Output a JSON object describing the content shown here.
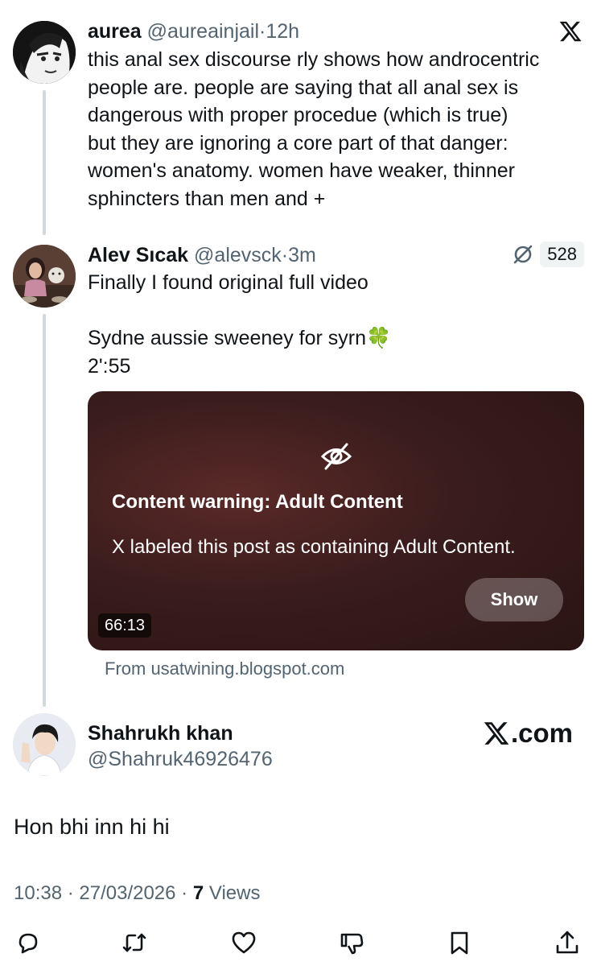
{
  "tweet1": {
    "name": "aurea",
    "handle": "@aureainjail",
    "sep": "·",
    "time": "12h",
    "lines": [
      "this anal sex discourse rly shows how androcentric",
      "people are. people are saying that all anal sex is",
      "dangerous with proper procedue (which is true)",
      "but they are ignoring a core part of that danger:",
      "women's anatomy. women have weaker, thinner",
      "sphincters than men and +"
    ]
  },
  "tweet2": {
    "name": "Alev Sıcak",
    "handle": "@alevsck",
    "sep": "·",
    "time": "3m",
    "badge_count": "528",
    "line1": "Finally I found original full video",
    "line2": "Sydne aussie sweeney for syrn🍀",
    "line3": "2':55",
    "media": {
      "warning_title": "Content warning: Adult Content",
      "warning_desc": "X labeled this post as containing Adult Content.",
      "show_label": "Show",
      "duration": "66:13"
    },
    "source": "From usatwining.blogspot.com"
  },
  "tweet3": {
    "name": "Shahrukh khan",
    "handle": "@Shahruk46926476",
    "brand": ".com",
    "text": "Hon bhi inn hi hi",
    "meta_time": "10:38 · 27/03/2026 ·",
    "views_count": "7",
    "views_label": "Views"
  },
  "icons": {
    "x_logo": "x-logo-icon",
    "link": "link-icon",
    "eye_off": "eye-off-icon",
    "reply": "reply-icon",
    "retweet": "retweet-icon",
    "like": "heart-icon",
    "dislike": "dislike-icon",
    "bookmark": "bookmark-icon",
    "share": "share-icon"
  },
  "colors": {
    "text": "#0f1419",
    "muted": "#536471",
    "thread": "#cfd9de",
    "media_bg": "#3a1c1c"
  }
}
